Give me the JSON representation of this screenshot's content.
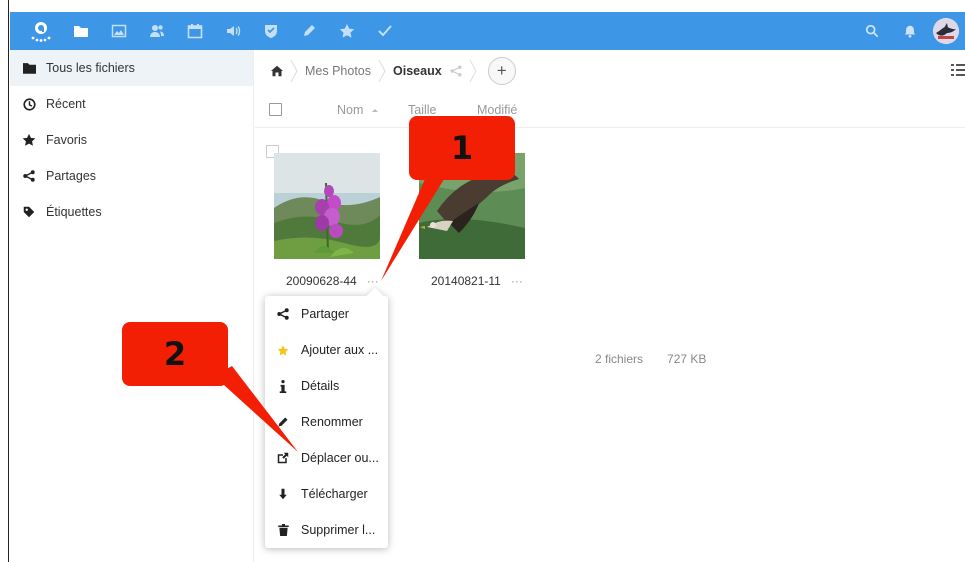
{
  "header": {
    "apps": [
      {
        "icon": "folder-icon",
        "name": "files"
      },
      {
        "icon": "image-icon",
        "name": "gallery"
      },
      {
        "icon": "contacts-icon",
        "name": "contacts"
      },
      {
        "icon": "calendar-icon",
        "name": "calendar"
      },
      {
        "icon": "audio-icon",
        "name": "audio"
      },
      {
        "icon": "shield-icon",
        "name": "security"
      },
      {
        "icon": "pencil-icon",
        "name": "notes"
      },
      {
        "icon": "star-icon",
        "name": "favorites"
      },
      {
        "icon": "check-icon",
        "name": "tasks"
      }
    ],
    "accent_color": "#3d96e6"
  },
  "sidebar": {
    "items": [
      {
        "label": "Tous les fichiers",
        "icon": "folder-icon"
      },
      {
        "label": "Récent",
        "icon": "clock-icon"
      },
      {
        "label": "Favoris",
        "icon": "star-icon"
      },
      {
        "label": "Partages",
        "icon": "share-icon"
      },
      {
        "label": "Étiquettes",
        "icon": "tag-icon"
      }
    ]
  },
  "breadcrumb": {
    "items": [
      "Mes Photos",
      "Oiseaux"
    ],
    "add_label": "+"
  },
  "columns": {
    "name": "Nom",
    "size": "Taille",
    "modified": "Modifié"
  },
  "files": [
    {
      "name": "20090628-44",
      "menu": "···"
    },
    {
      "name": "20140821-11",
      "menu": "···"
    }
  ],
  "summary": {
    "count": "2 fichiers",
    "size": "727 KB"
  },
  "menu": {
    "items": [
      {
        "label": "Partager",
        "icon": "share-icon"
      },
      {
        "label": "Ajouter aux ...",
        "icon": "star-icon"
      },
      {
        "label": "Détails",
        "icon": "info-icon"
      },
      {
        "label": "Renommer",
        "icon": "pencil-icon"
      },
      {
        "label": "Déplacer ou...",
        "icon": "external-icon"
      },
      {
        "label": "Télécharger",
        "icon": "download-icon"
      },
      {
        "label": "Supprimer l...",
        "icon": "trash-icon"
      }
    ]
  },
  "annotations": {
    "badge1": "1",
    "badge2": "2",
    "color": "#f21f05"
  }
}
